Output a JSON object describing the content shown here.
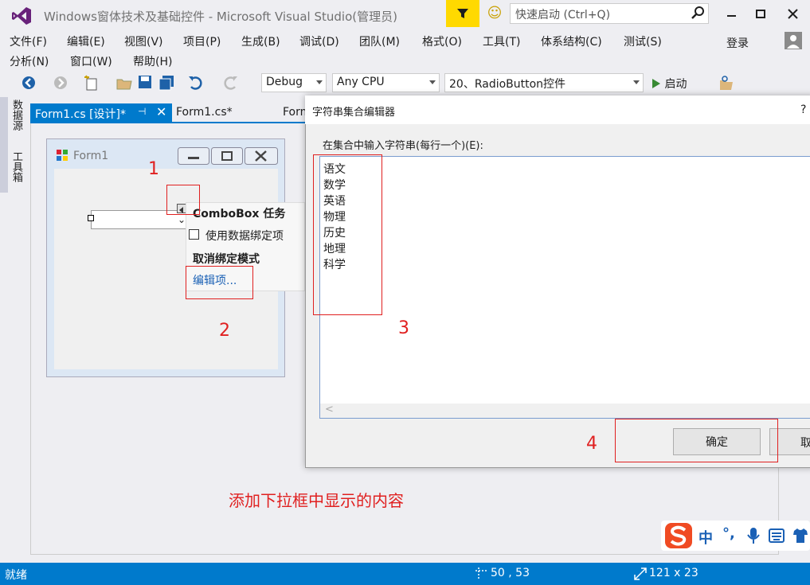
{
  "window": {
    "title": "Windows窗体技术及基础控件 - Microsoft Visual Studio(管理员)",
    "quick_launch_placeholder": "快速启动 (Ctrl+Q)",
    "login": "登录"
  },
  "menu": {
    "row1": [
      "文件(F)",
      "编辑(E)",
      "视图(V)",
      "项目(P)",
      "生成(B)",
      "调试(D)",
      "团队(M)",
      "格式(O)",
      "工具(T)",
      "体系结构(C)",
      "测试(S)"
    ],
    "row2": [
      "分析(N)",
      "窗口(W)",
      "帮助(H)"
    ]
  },
  "toolbar": {
    "config": "Debug",
    "platform": "Any CPU",
    "startup_project": "20、RadioButton控件",
    "start_label": "启动"
  },
  "side_tabs": [
    "数据源",
    "工具箱"
  ],
  "tabs": [
    "Form1.cs [设计]*",
    "Form1.cs*",
    "Form"
  ],
  "designer": {
    "form_title": "Form1",
    "tasks_title": "ComboBox 任务",
    "use_data_bound": "使用数据绑定项",
    "unbind_mode": "取消绑定模式",
    "edit_items": "编辑项..."
  },
  "dialog": {
    "title": "字符串集合编辑器",
    "help": "?",
    "label": "在集合中输入字符串(每行一个)(E):",
    "lines": [
      "语文",
      "数学",
      "英语",
      "物理",
      "历史",
      "地理",
      "科学"
    ],
    "scroll_left": "<",
    "ok": "确定",
    "cancel": "取"
  },
  "annotations": {
    "n1": "1",
    "n2": "2",
    "n3": "3",
    "n4": "4",
    "caption": "添加下拉框中显示的内容"
  },
  "statusbar": {
    "ready": "就绪",
    "position": "50 , 53",
    "size": "121 x 23"
  },
  "ime": {
    "mode": "中",
    "punct": "°,"
  },
  "colors": {
    "accent": "#007acc",
    "annotation": "#e02020",
    "filter": "#ffd900"
  }
}
